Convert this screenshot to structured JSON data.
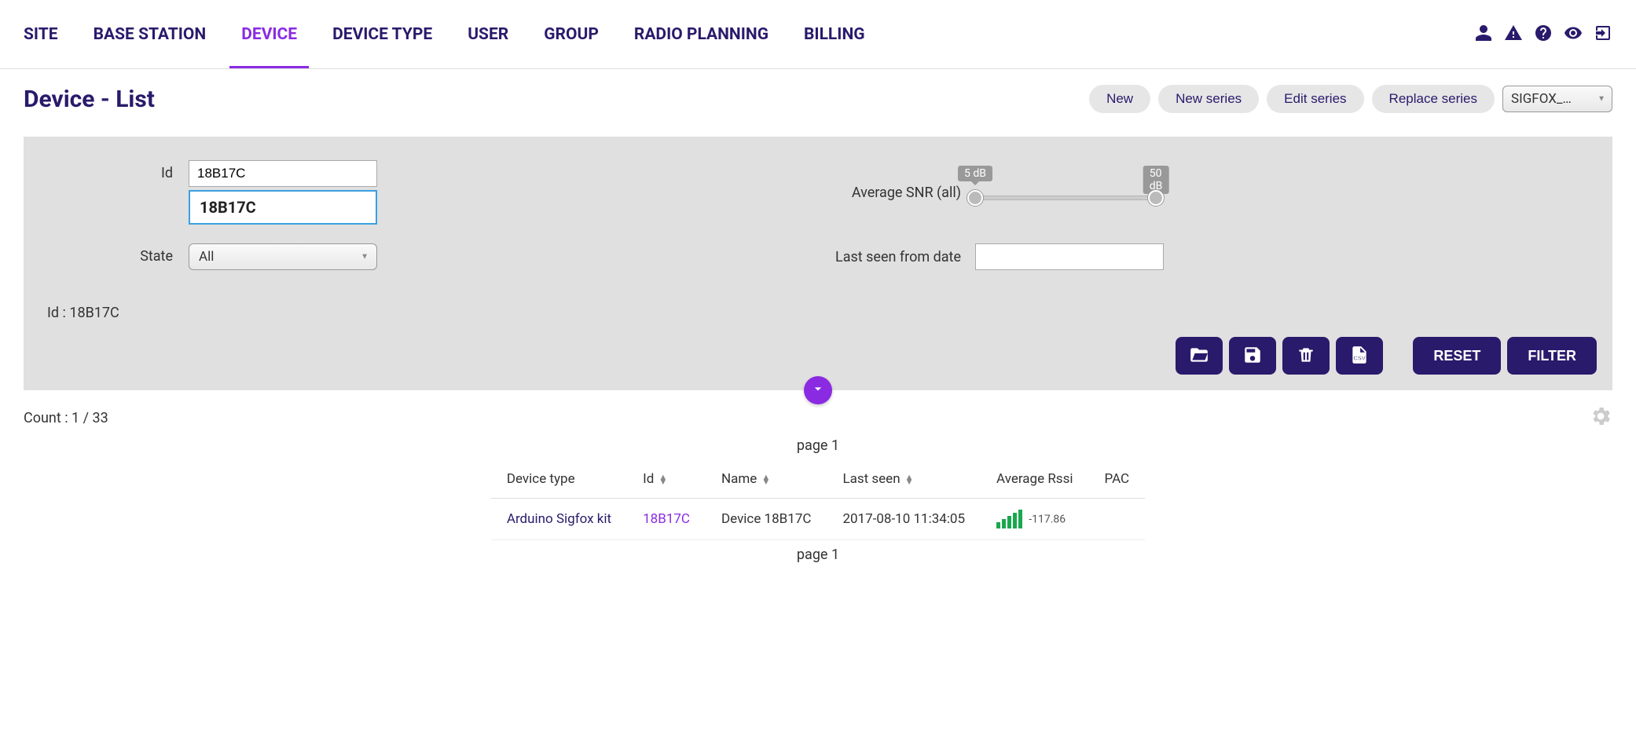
{
  "nav": {
    "items": [
      "SITE",
      "BASE STATION",
      "DEVICE",
      "DEVICE TYPE",
      "USER",
      "GROUP",
      "RADIO PLANNING",
      "BILLING"
    ],
    "active_index": 2
  },
  "page": {
    "title": "Device - List"
  },
  "actions": {
    "new": "New",
    "new_series": "New series",
    "edit_series": "Edit series",
    "replace_series": "Replace series",
    "group_selected": "SIGFOX_…"
  },
  "filter": {
    "id_label": "Id",
    "id_value": "18B17C",
    "id_suggestion": "18B17C",
    "state_label": "State",
    "state_value": "All",
    "snr_label": "Average SNR (all)",
    "snr_min": "5 dB",
    "snr_max": "50 dB",
    "lastseen_label": "Last seen from date",
    "lastseen_value": "",
    "status_line": "Id : 18B17C",
    "reset": "RESET",
    "filter_btn": "FILTER"
  },
  "results": {
    "count_text": "Count : 1 / 33",
    "pager": "page 1",
    "columns": {
      "device_type": "Device type",
      "id": "Id",
      "name": "Name",
      "last_seen": "Last seen",
      "avg_rssi": "Average Rssi",
      "pac": "PAC"
    },
    "rows": [
      {
        "device_type": "Arduino Sigfox kit",
        "id": "18B17C",
        "name": "Device 18B17C",
        "last_seen": "2017-08-10 11:34:05",
        "avg_rssi": "-117.86",
        "pac": ""
      }
    ]
  }
}
